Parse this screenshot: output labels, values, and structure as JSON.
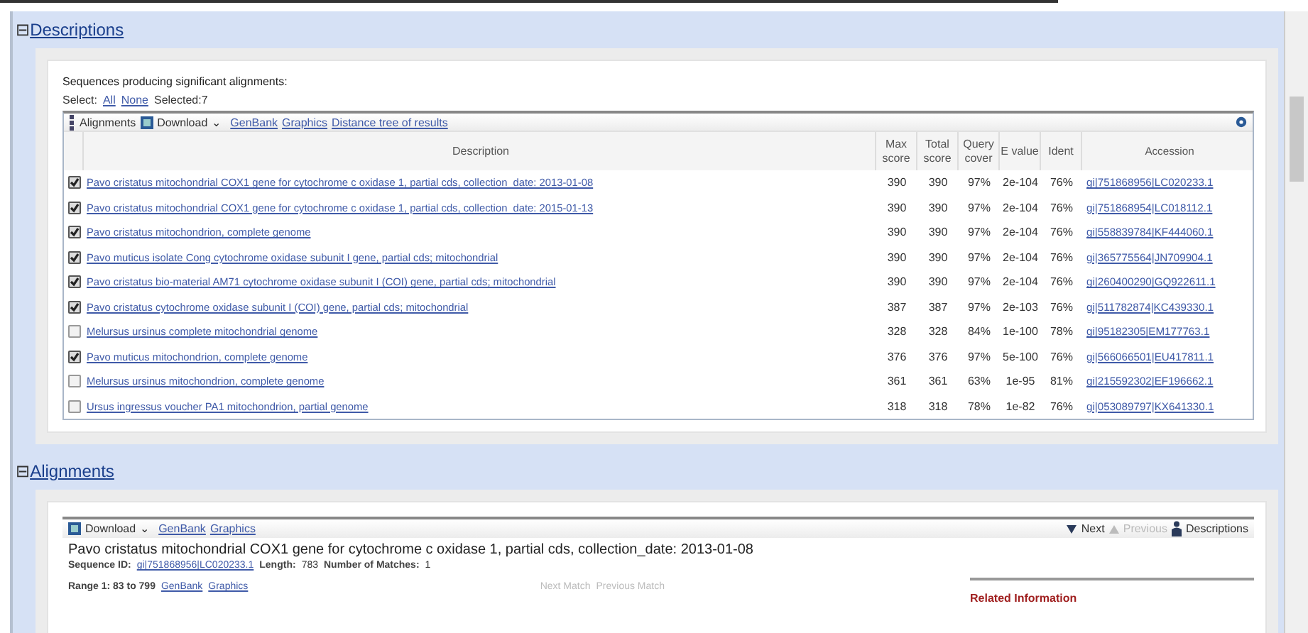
{
  "descriptions": {
    "toggle": "⊟",
    "title": "Descriptions",
    "heading": "Sequences producing significant alignments:",
    "select_label": "Select:",
    "select_all": "All",
    "select_none": "None",
    "selected_count": "Selected:7",
    "toolbar": {
      "alignments": "Alignments",
      "download": "Download",
      "caret": "⌄",
      "links": [
        "GenBank",
        "Graphics",
        "Distance tree of results"
      ]
    },
    "columns": [
      "Description",
      "Max score",
      "Total score",
      "Query cover",
      "E value",
      "Ident",
      "Accession"
    ],
    "rows": [
      {
        "checked": true,
        "description": "Pavo cristatus mitochondrial COX1 gene for cytochrome c oxidase 1, partial cds, collection_date: 2013-01-08",
        "max_score": "390",
        "total_score": "390",
        "query_cover": "97%",
        "e_value": "2e-104",
        "ident": "76%",
        "accession": "gi|751868956|LC020233.1"
      },
      {
        "checked": true,
        "description": "Pavo cristatus mitochondrial COX1 gene for cytochrome c oxidase 1, partial cds, collection_date: 2015-01-13",
        "max_score": "390",
        "total_score": "390",
        "query_cover": "97%",
        "e_value": "2e-104",
        "ident": "76%",
        "accession": "gi|751868954|LC018112.1"
      },
      {
        "checked": true,
        "description": "Pavo cristatus mitochondrion, complete genome",
        "max_score": "390",
        "total_score": "390",
        "query_cover": "97%",
        "e_value": "2e-104",
        "ident": "76%",
        "accession": "gi|558839784|KF444060.1"
      },
      {
        "checked": true,
        "description": "Pavo muticus isolate Cong cytochrome oxidase subunit I gene, partial cds; mitochondrial",
        "max_score": "390",
        "total_score": "390",
        "query_cover": "97%",
        "e_value": "2e-104",
        "ident": "76%",
        "accession": "gi|365775564|JN709904.1"
      },
      {
        "checked": true,
        "description": "Pavo cristatus bio-material AM71 cytochrome oxidase subunit I (COI) gene, partial cds; mitochondrial",
        "max_score": "390",
        "total_score": "390",
        "query_cover": "97%",
        "e_value": "2e-104",
        "ident": "76%",
        "accession": "gi|260400290|GQ922611.1"
      },
      {
        "checked": true,
        "description": "Pavo cristatus cytochrome oxidase subunit I (COI) gene, partial cds; mitochondrial",
        "max_score": "387",
        "total_score": "387",
        "query_cover": "97%",
        "e_value": "2e-103",
        "ident": "76%",
        "accession": "gi|511782874|KC439330.1"
      },
      {
        "checked": false,
        "description": "Melursus ursinus complete mitochondrial genome",
        "max_score": "328",
        "total_score": "328",
        "query_cover": "84%",
        "e_value": "1e-100",
        "ident": "78%",
        "accession": "gi|95182305|EM177763.1"
      },
      {
        "checked": true,
        "description": "Pavo muticus mitochondrion, complete genome",
        "max_score": "376",
        "total_score": "376",
        "query_cover": "97%",
        "e_value": "5e-100",
        "ident": "76%",
        "accession": "gi|566066501|EU417811.1"
      },
      {
        "checked": false,
        "description": "Melursus ursinus mitochondrion, complete genome",
        "max_score": "361",
        "total_score": "361",
        "query_cover": "63%",
        "e_value": "1e-95",
        "ident": "81%",
        "accession": "gi|215592302|EF196662.1"
      },
      {
        "checked": false,
        "description": "Ursus ingressus voucher PA1 mitochondrion, partial genome",
        "max_score": "318",
        "total_score": "318",
        "query_cover": "78%",
        "e_value": "1e-82",
        "ident": "76%",
        "accession": "gi|053089797|KX641330.1"
      }
    ]
  },
  "alignments": {
    "toggle": "⊟",
    "title": "Alignments",
    "toolbar": {
      "download": "Download",
      "caret": "⌄",
      "links": [
        "GenBank",
        "Graphics"
      ],
      "next": "Next",
      "previous": "Previous",
      "descriptions": "Descriptions"
    },
    "title_line": "Pavo cristatus mitochondrial COX1 gene for cytochrome c oxidase 1, partial cds, collection_date: 2013-01-08",
    "sequence_id_label": "Sequence ID:",
    "sequence_id": "gi|751868956|LC020233.1",
    "length_label": "Length:",
    "length": "783",
    "matches_label": "Number of Matches:",
    "matches": "1",
    "range": "Range 1: 83 to 799",
    "range_links": [
      "GenBank",
      "Graphics"
    ],
    "next_match": "Next Match",
    "previous_match": "Previous Match",
    "related": "Related Information"
  }
}
